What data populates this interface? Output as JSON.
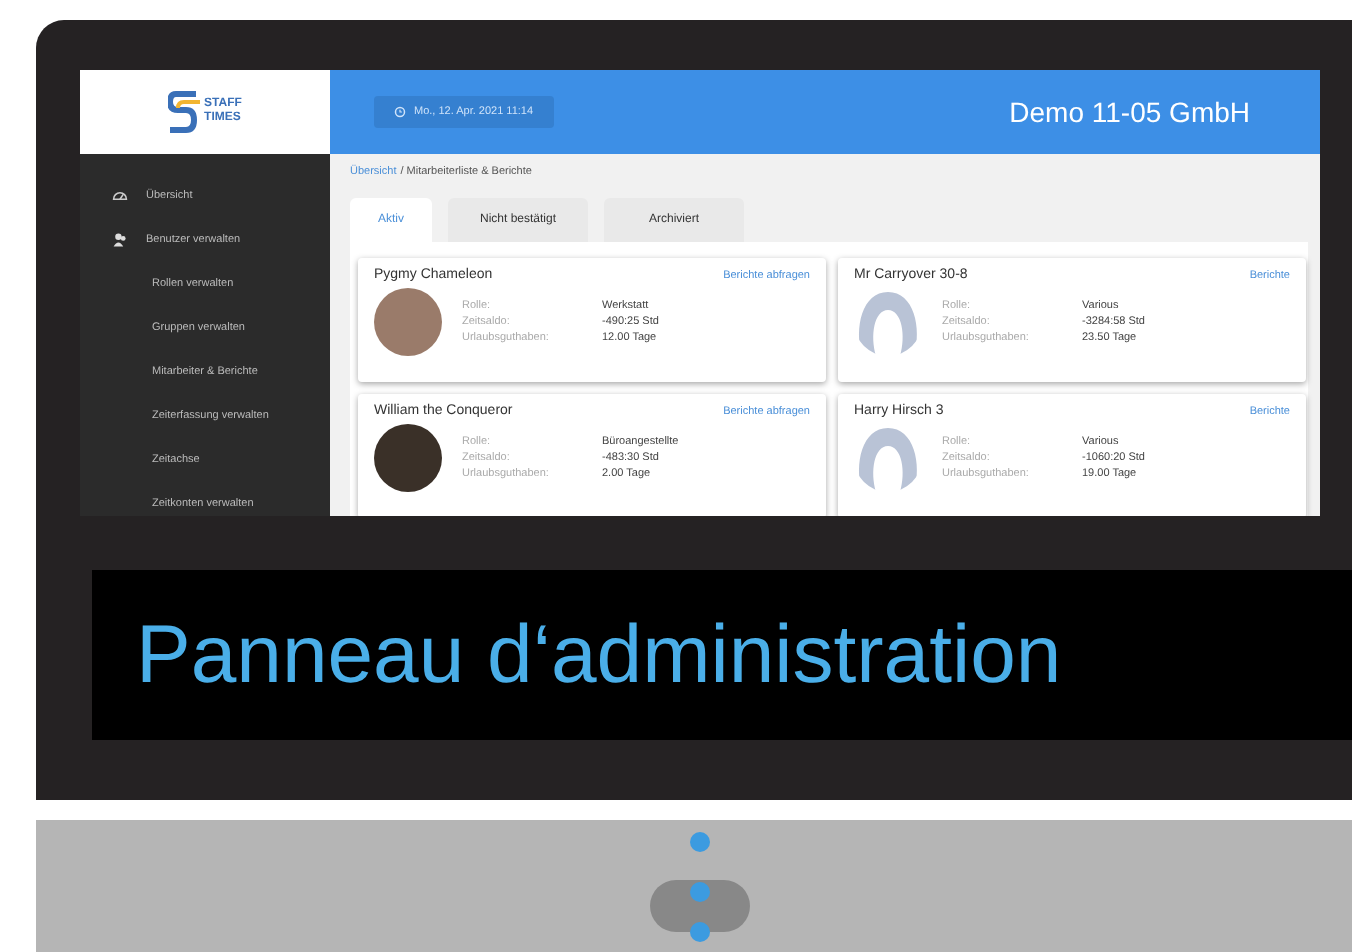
{
  "logo": {
    "line1": "STAFF",
    "line2": "TIMES"
  },
  "header": {
    "datetime": "Mo., 12. Apr. 2021 11:14",
    "company": "Demo 11-05 GmbH"
  },
  "sidebar": {
    "items": [
      {
        "label": "Übersicht"
      },
      {
        "label": "Benutzer verwalten",
        "children": [
          {
            "label": "Rollen verwalten"
          },
          {
            "label": "Gruppen verwalten"
          },
          {
            "label": "Mitarbeiter & Berichte"
          },
          {
            "label": "Zeiterfassung verwalten"
          },
          {
            "label": "Zeitachse"
          },
          {
            "label": "Zeitkonten verwalten"
          }
        ]
      }
    ]
  },
  "breadcrumb": {
    "link": "Übersicht",
    "current": "/ Mitarbeiterliste & Berichte"
  },
  "tabs": [
    {
      "label": "Aktiv",
      "selected": true
    },
    {
      "label": "Nicht bestätigt",
      "selected": false
    },
    {
      "label": "Archiviert",
      "selected": false
    }
  ],
  "employees": [
    {
      "name": "Pygmy Chameleon",
      "link": "Berichte abfragen",
      "kind": "photo",
      "fields": [
        {
          "label": "Rolle:",
          "value": "Werkstatt"
        },
        {
          "label": "Zeitsaldo:",
          "value": "-490:25 Std"
        },
        {
          "label": "Urlaubsguthaben:",
          "value": "12.00 Tage"
        }
      ]
    },
    {
      "name": "Mr Carryover 30-8",
      "link": "Berichte",
      "kind": "silhouette",
      "fields": [
        {
          "label": "Rolle:",
          "value": "Various"
        },
        {
          "label": "Zeitsaldo:",
          "value": "-3284:58 Std"
        },
        {
          "label": "Urlaubsguthaben:",
          "value": "23.50 Tage"
        }
      ]
    },
    {
      "name": "William the Conqueror",
      "link": "Berichte abfragen",
      "kind": "photo",
      "fields": [
        {
          "label": "Rolle:",
          "value": "Büroangestellte"
        },
        {
          "label": "Zeitsaldo:",
          "value": "-483:30 Std"
        },
        {
          "label": "Urlaubsguthaben:",
          "value": "2.00 Tage"
        }
      ]
    },
    {
      "name": "Harry Hirsch 3",
      "link": "Berichte",
      "kind": "silhouette",
      "fields": [
        {
          "label": "Rolle:",
          "value": "Various"
        },
        {
          "label": "Zeitsaldo:",
          "value": "-1060:20 Std"
        },
        {
          "label": "Urlaubsguthaben:",
          "value": "19.00 Tage"
        }
      ]
    }
  ],
  "caption": "Panneau d‘administration"
}
